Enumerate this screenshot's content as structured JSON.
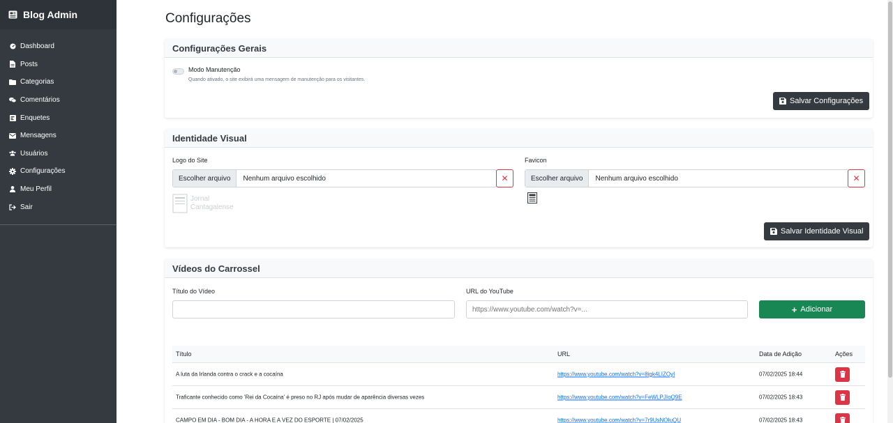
{
  "sidebar": {
    "brand": "Blog Admin",
    "items": [
      {
        "label": "Dashboard",
        "icon": "dashboard-icon"
      },
      {
        "label": "Posts",
        "icon": "file-icon"
      },
      {
        "label": "Categorias",
        "icon": "folder-icon"
      },
      {
        "label": "Comentários",
        "icon": "comments-icon"
      },
      {
        "label": "Enquetes",
        "icon": "poll-icon"
      },
      {
        "label": "Mensagens",
        "icon": "envelope-icon"
      },
      {
        "label": "Usuários",
        "icon": "users-icon"
      },
      {
        "label": "Configurações",
        "icon": "gear-icon"
      },
      {
        "label": "Meu Perfil",
        "icon": "user-icon"
      },
      {
        "label": "Sair",
        "icon": "logout-icon"
      }
    ]
  },
  "page": {
    "title": "Configurações"
  },
  "general": {
    "title": "Configurações Gerais",
    "maintenance_label": "Modo Manutenção",
    "maintenance_hint": "Quando ativado, o site exibirá uma mensagem de manutenção para os visitantes.",
    "save_label": "Salvar Configurações"
  },
  "identity": {
    "title": "Identidade Visual",
    "logo_label": "Logo do Site",
    "favicon_label": "Favicon",
    "choose_file": "Escolher arquivo",
    "no_file": "Nenhum arquivo escolhido",
    "logo_alt": "Jornal Cantagalense",
    "save_label": "Salvar Identidade Visual"
  },
  "videos": {
    "title": "Vídeos do Carrossel",
    "title_label": "Título do Vídeo",
    "url_label": "URL do YouTube",
    "url_placeholder": "https://www.youtube.com/watch?v=...",
    "add_label": "Adicionar",
    "columns": [
      "Título",
      "URL",
      "Data de Adição",
      "Ações"
    ],
    "rows": [
      {
        "title": "A luta da Irlanda contra o crack e a cocaína",
        "url": "https://www.youtube.com/watch?v=8igk4LIZOyI",
        "date": "07/02/2025 18:44"
      },
      {
        "title": "Traficante conhecido como 'Rei da Cocaína' é preso no RJ após mudar de aparência diversas vezes",
        "url": "https://www.youtube.com/watch?v=FeWLPJIoQ9E",
        "date": "07/02/2025 18:43"
      },
      {
        "title": "CAMPO EM DIA - BOM DIA - A HORA E A VEZ DO ESPORTE | 07/02/2025",
        "url": "https://www.youtube.com/watch?v=7r9UsNOIuQU",
        "date": "07/02/2025 18:43"
      }
    ]
  },
  "colors": {
    "sidebar": "#343a40",
    "primary_dark": "#343a40",
    "success": "#198754",
    "danger": "#dc3545"
  }
}
